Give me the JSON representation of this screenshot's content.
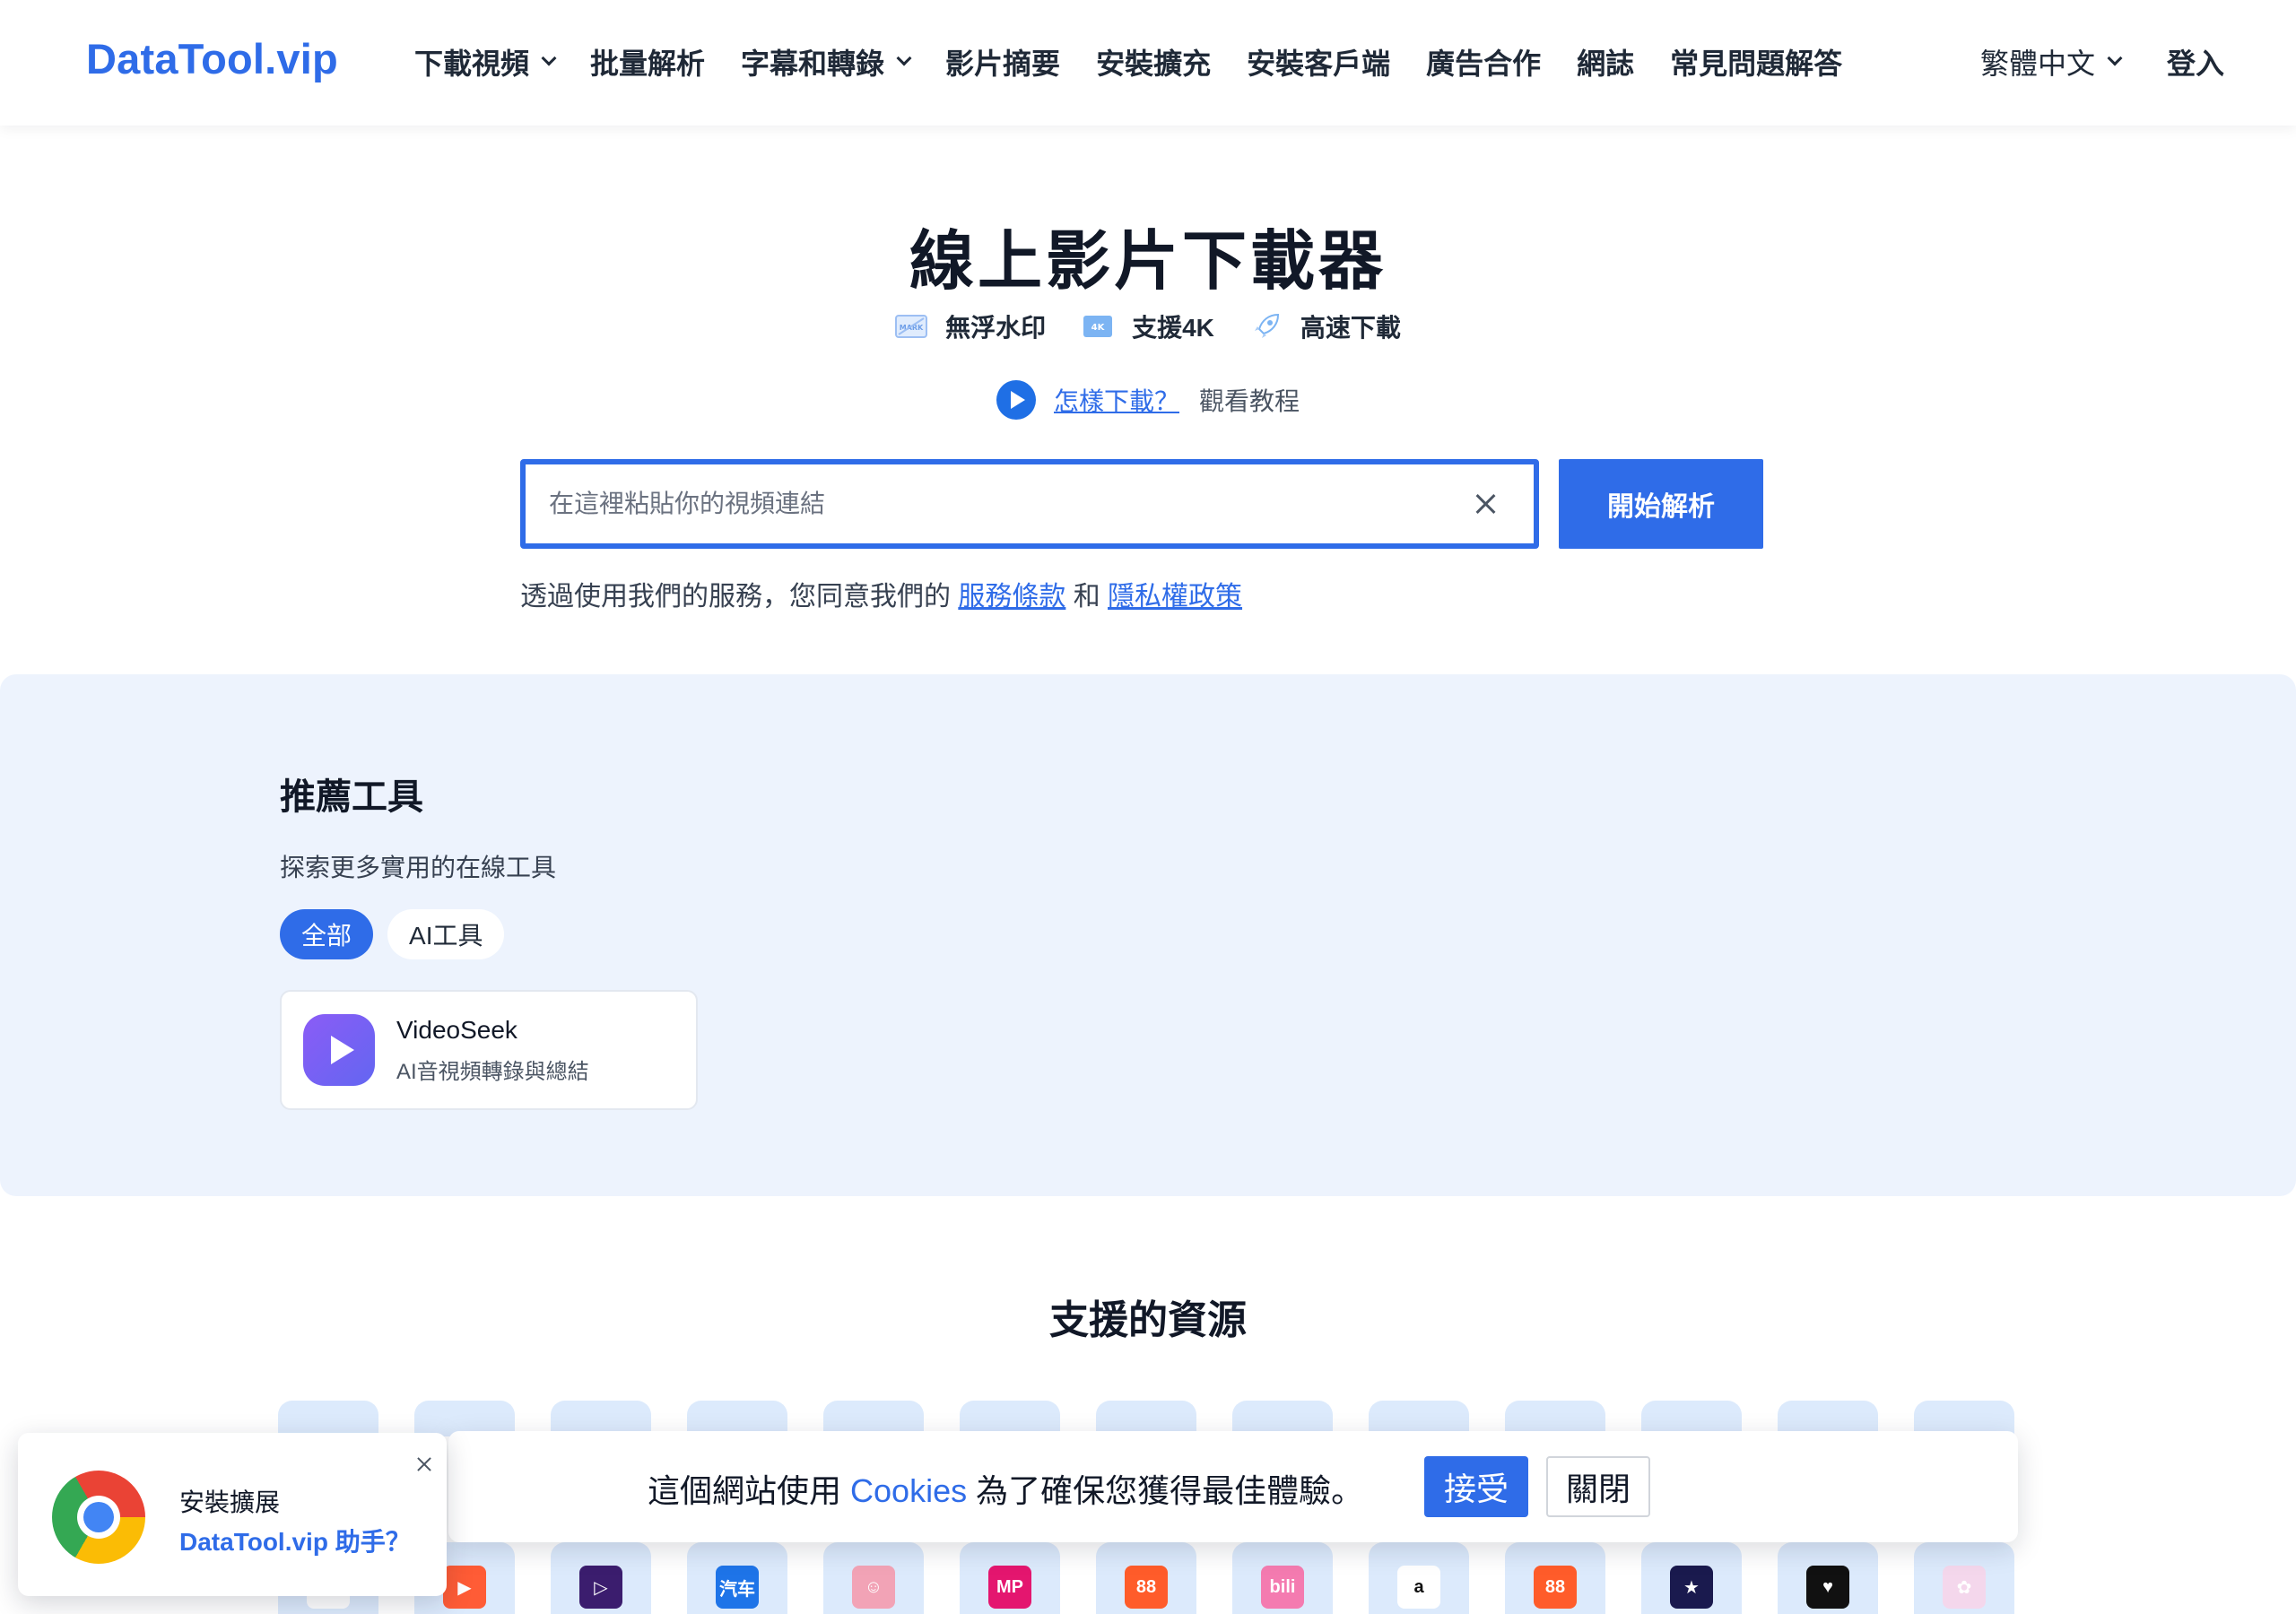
{
  "nav": {
    "brand": "DataTool.vip",
    "items": [
      {
        "label": "下載視頻",
        "has_dropdown": true
      },
      {
        "label": "批量解析",
        "has_dropdown": false
      },
      {
        "label": "字幕和轉錄",
        "has_dropdown": true
      },
      {
        "label": "影片摘要",
        "has_dropdown": false
      },
      {
        "label": "安裝擴充",
        "has_dropdown": false
      },
      {
        "label": "安裝客戶端",
        "has_dropdown": false
      },
      {
        "label": "廣告合作",
        "has_dropdown": false
      },
      {
        "label": "網誌",
        "has_dropdown": false
      },
      {
        "label": "常見問題解答",
        "has_dropdown": false
      }
    ],
    "language": "繁體中文",
    "login": "登入"
  },
  "hero": {
    "title": "線上影片下載器",
    "features": [
      {
        "icon": "no-watermark-icon",
        "label": "無浮水印"
      },
      {
        "icon": "4k-icon",
        "label": "支援4K"
      },
      {
        "icon": "rocket-icon",
        "label": "高速下載"
      }
    ],
    "howto_link": "怎樣下載？",
    "howto_text": "觀看教程"
  },
  "search": {
    "placeholder": "在這裡粘貼你的視頻連結",
    "value": "",
    "button": "開始解析"
  },
  "terms": {
    "prefix": "透過使用我們的服務，您同意我們的",
    "tos": "服務條款",
    "and": "和",
    "privacy": "隱私權政策"
  },
  "tools": {
    "title": "推薦工具",
    "subtitle": "探索更多實用的在線工具",
    "tabs": [
      {
        "label": "全部",
        "active": true
      },
      {
        "label": "AI工具",
        "active": false
      }
    ],
    "cards": [
      {
        "name": "VideoSeek",
        "desc": "AI音視頻轉錄與總結"
      }
    ]
  },
  "sources": {
    "title": "支援的資源",
    "icons": [
      {
        "name": "weibo-icon",
        "color": "#ffffff",
        "text": ""
      },
      {
        "name": "kuaishou-icon",
        "color": "#ff5c36",
        "text": "▶"
      },
      {
        "name": "video-player-icon",
        "color": "#3b1d6e",
        "text": "▷"
      },
      {
        "name": "autohome-icon",
        "color": "#1e74e8",
        "text": "汽车"
      },
      {
        "name": "cartoon-face-icon",
        "color": "#f2a3b6",
        "text": "☺"
      },
      {
        "name": "mp-icon",
        "color": "#e4166f",
        "text": "MP"
      },
      {
        "name": "kuaishou-grid-icon",
        "color": "#ff5c2a",
        "text": "88"
      },
      {
        "name": "bilibili-icon",
        "color": "#f47bb0",
        "text": "bili"
      },
      {
        "name": "amazon-icon",
        "color": "#ffffff",
        "text": "a"
      },
      {
        "name": "kuaishou-grid-icon-2",
        "color": "#ff5c2a",
        "text": "88"
      },
      {
        "name": "star-icon",
        "color": "#1a1a4e",
        "text": "★"
      },
      {
        "name": "heart-icon",
        "color": "#111111",
        "text": "♥"
      },
      {
        "name": "leaf-icon",
        "color": "#f4d7ec",
        "text": "✿"
      }
    ]
  },
  "cookie": {
    "text_before": "這個網站使用",
    "cookies_word": "Cookies",
    "text_after": "為了確保您獲得最佳體驗。",
    "accept": "接受",
    "close": "關閉"
  },
  "extension_popup": {
    "line1": "安裝擴展",
    "line2": "DataTool.vip 助手？"
  },
  "colors": {
    "accent": "#2f6ce8",
    "tools_bg": "#edf3fd",
    "source_tile_bg": "#dceafc"
  }
}
